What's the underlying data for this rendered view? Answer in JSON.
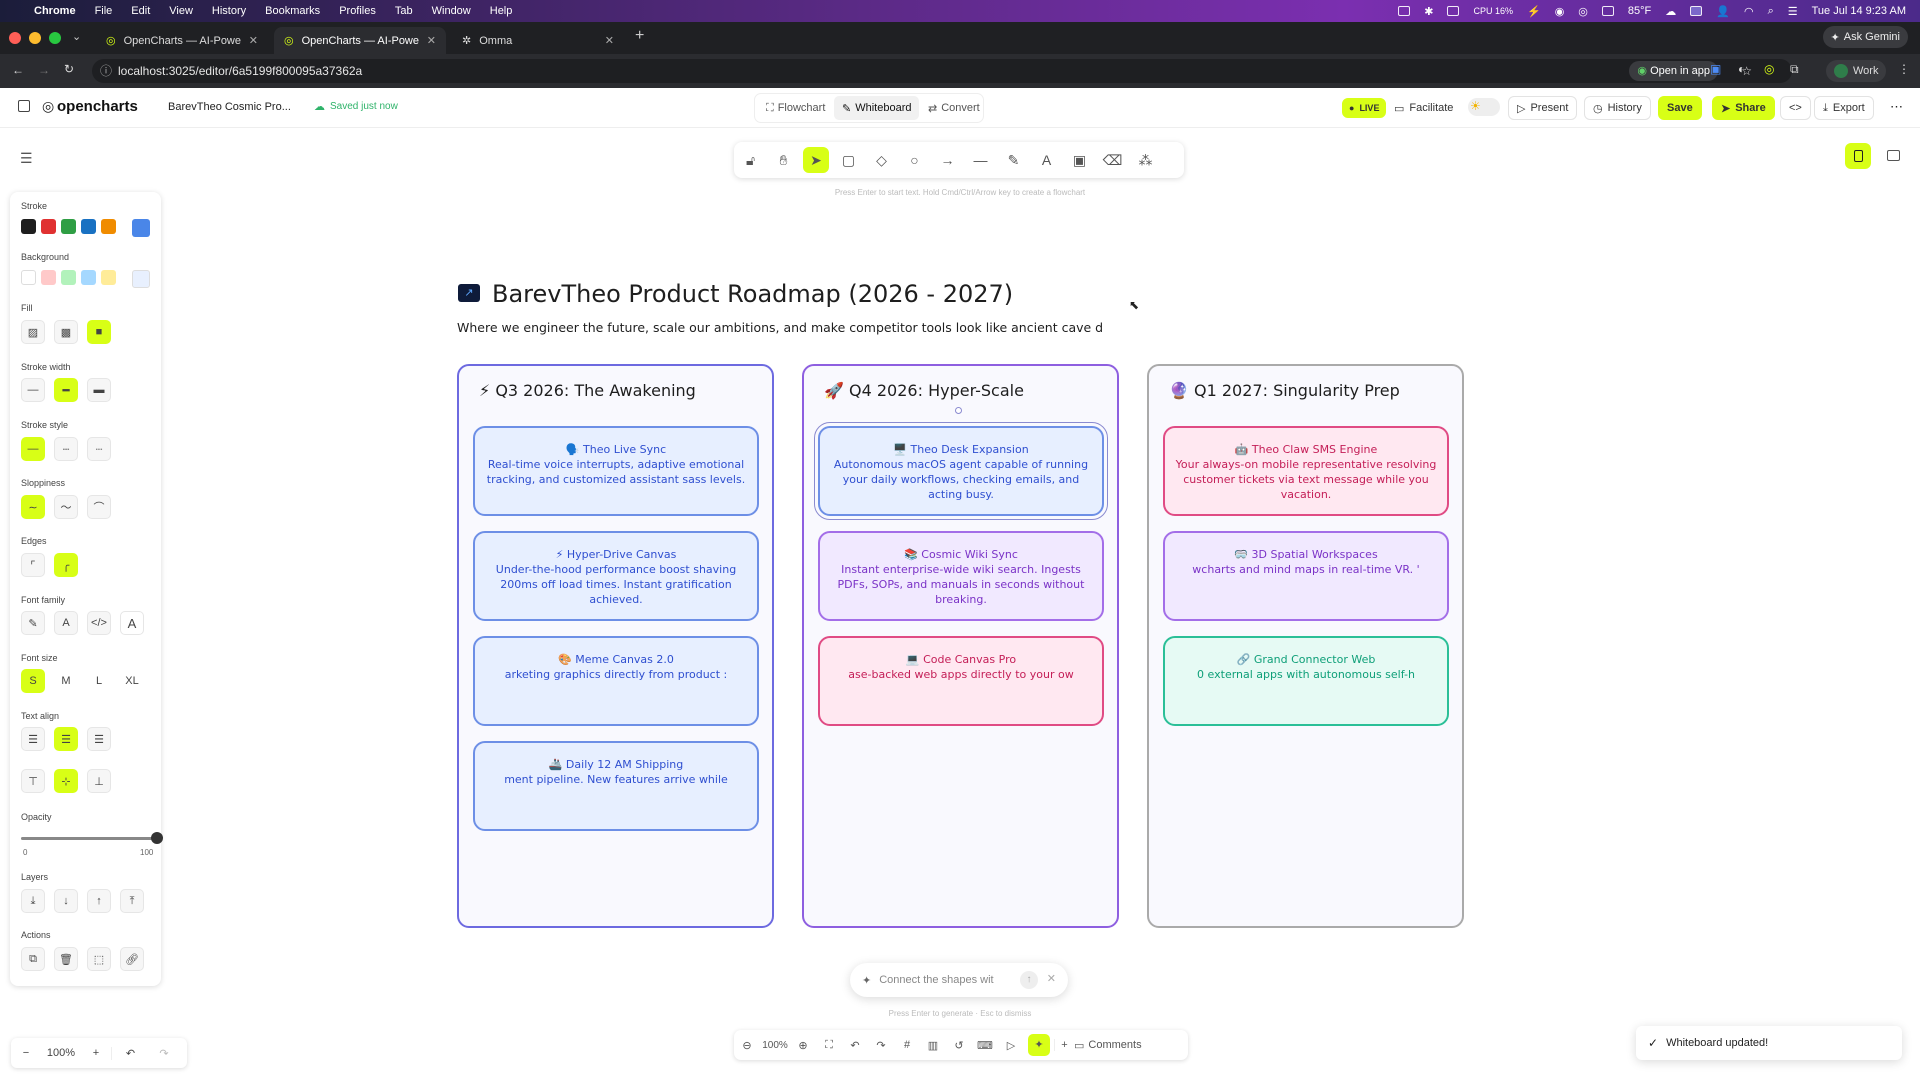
{
  "menubar": {
    "app": "Chrome",
    "items": [
      "File",
      "Edit",
      "View",
      "History",
      "Bookmarks",
      "Profiles",
      "Tab",
      "Window",
      "Help"
    ],
    "cpu": "CPU 16%",
    "weather": "85°F",
    "datetime": "Tue Jul 14  9:23 AM"
  },
  "browser": {
    "tabs": [
      {
        "title": "OpenCharts — AI-Powered Fl"
      },
      {
        "title": "OpenCharts — AI-Powered Fl"
      },
      {
        "title": "Omma"
      }
    ],
    "ask_gemini": "Ask Gemini",
    "url": "localhost:3025/editor/6a5199f800095a37362a",
    "open_in_app": "Open in app",
    "profile": "Work"
  },
  "app": {
    "logo": "opencharts",
    "doc_title": "BarevTheo Cosmic Pro...",
    "save_status": "Saved just now",
    "modes": [
      "Flowchart",
      "Whiteboard",
      "Convert"
    ],
    "live": "LIVE",
    "facilitate": "Facilitate",
    "present": "Present",
    "history": "History",
    "save": "Save",
    "share": "Share",
    "export": "Export",
    "toolbar_hint": "Press Enter to start text. Hold Cmd/Ctrl/Arrow key to create a flowchart"
  },
  "panel": {
    "stroke": "Stroke",
    "background": "Background",
    "fill": "Fill",
    "stroke_width": "Stroke width",
    "stroke_style": "Stroke style",
    "sloppiness": "Sloppiness",
    "edges": "Edges",
    "font_family": "Font family",
    "font_size": "Font size",
    "font_sizes": [
      "S",
      "M",
      "L",
      "XL"
    ],
    "text_align": "Text align",
    "opacity": "Opacity",
    "opacity_min": "0",
    "opacity_max": "100",
    "opacity_value": 100,
    "layers": "Layers",
    "actions": "Actions",
    "stroke_colors": [
      "#1e1e1e",
      "#e03131",
      "#2f9e44",
      "#1971c2",
      "#f08c00",
      "#4a86e8"
    ],
    "background_colors": [
      "#ffffff",
      "#ffc9c9",
      "#b2f2bb",
      "#a5d8ff",
      "#ffec99",
      "#e8f0fe"
    ]
  },
  "board": {
    "title": "BarevTheo Product Roadmap (2026 - 2027)",
    "subtitle": "Where we engineer the future, scale our ambitions, and make competitor tools look like ancient cave d",
    "columns": [
      {
        "title": "⚡ Q3 2026: The Awakening",
        "cards": [
          {
            "title": "🗣️ Theo Live Sync",
            "body": "Real-time voice interrupts, adaptive emotional tracking, and customized assistant sass levels."
          },
          {
            "title": "⚡ Hyper-Drive Canvas",
            "body": "Under-the-hood performance boost shaving 200ms off load times. Instant gratification achieved."
          },
          {
            "title": "🎨 Meme Canvas 2.0",
            "body": "arketing graphics directly from product :"
          },
          {
            "title": "🚢 Daily 12 AM Shipping",
            "body": "ment pipeline. New features arrive while"
          }
        ]
      },
      {
        "title": "🚀 Q4 2026: Hyper-Scale",
        "cards": [
          {
            "title": "🖥️ Theo Desk Expansion",
            "body": "Autonomous macOS agent capable of running your daily workflows, checking emails, and acting busy."
          },
          {
            "title": "📚 Cosmic Wiki Sync",
            "body": "Instant enterprise-wide wiki search. Ingests PDFs, SOPs, and manuals in seconds without breaking."
          },
          {
            "title": "💻 Code Canvas Pro",
            "body": "ase-backed web apps directly to your ow"
          }
        ]
      },
      {
        "title": "🔮 Q1 2027: Singularity Prep",
        "cards": [
          {
            "title": "🤖 Theo Claw SMS Engine",
            "body": "Your always-on mobile representative resolving customer tickets via text message while you vacation."
          },
          {
            "title": "🥽 3D Spatial Workspaces",
            "body": "wcharts and mind maps in real-time VR. '"
          },
          {
            "title": "🔗 Grand Connector Web",
            "body": "0 external apps with autonomous self-h"
          }
        ]
      }
    ]
  },
  "bottom": {
    "zoom": "100%",
    "bar_zoom": "100%",
    "comments": "Comments",
    "prompt_placeholder": "Connect the shapes wit",
    "prompt_hint": "Press  Enter  to generate  ·  Esc  to dismiss",
    "toast": "Whiteboard updated!"
  }
}
